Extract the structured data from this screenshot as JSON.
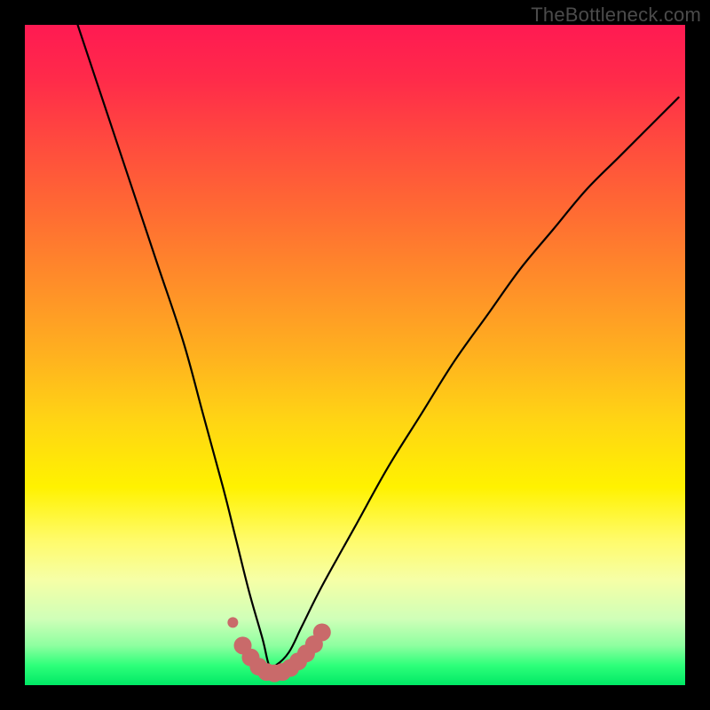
{
  "watermark": "TheBottleneck.com",
  "colors": {
    "curve": "#000000",
    "marker_fill": "#c96a6a",
    "marker_stroke": "#b34e4e",
    "background_black": "#000000"
  },
  "chart_data": {
    "type": "line",
    "title": "",
    "xlabel": "",
    "ylabel": "",
    "xlim": [
      0,
      100
    ],
    "ylim": [
      0,
      100
    ],
    "curve": {
      "name": "bottleneck-v-curve",
      "comment": "V-shaped curve. Values are percent of plot area: x left→right, y bottom→top. Minimum near x≈37.",
      "x": [
        8,
        12,
        16,
        20,
        24,
        27,
        30,
        32,
        34,
        36,
        37,
        38,
        40,
        42,
        45,
        50,
        55,
        60,
        65,
        70,
        75,
        80,
        85,
        90,
        95,
        99
      ],
      "y": [
        100,
        88,
        76,
        64,
        52,
        41,
        30,
        22,
        14,
        7,
        3,
        3,
        5,
        9,
        15,
        24,
        33,
        41,
        49,
        56,
        63,
        69,
        75,
        80,
        85,
        89
      ]
    },
    "markers": {
      "name": "highlighted-region",
      "comment": "Thick salmon markers tracing the trough of the curve plus one small detached dot on the left limb.",
      "detached_point": {
        "x": 31.5,
        "y": 9.5,
        "r": 6
      },
      "trough_points": [
        {
          "x": 33.0,
          "y": 6.0
        },
        {
          "x": 34.2,
          "y": 4.2
        },
        {
          "x": 35.4,
          "y": 2.8
        },
        {
          "x": 36.6,
          "y": 2.0
        },
        {
          "x": 37.8,
          "y": 1.8
        },
        {
          "x": 39.0,
          "y": 2.0
        },
        {
          "x": 40.2,
          "y": 2.6
        },
        {
          "x": 41.4,
          "y": 3.6
        },
        {
          "x": 42.6,
          "y": 4.8
        },
        {
          "x": 43.8,
          "y": 6.2
        },
        {
          "x": 45.0,
          "y": 8.0
        }
      ],
      "r": 10
    }
  }
}
